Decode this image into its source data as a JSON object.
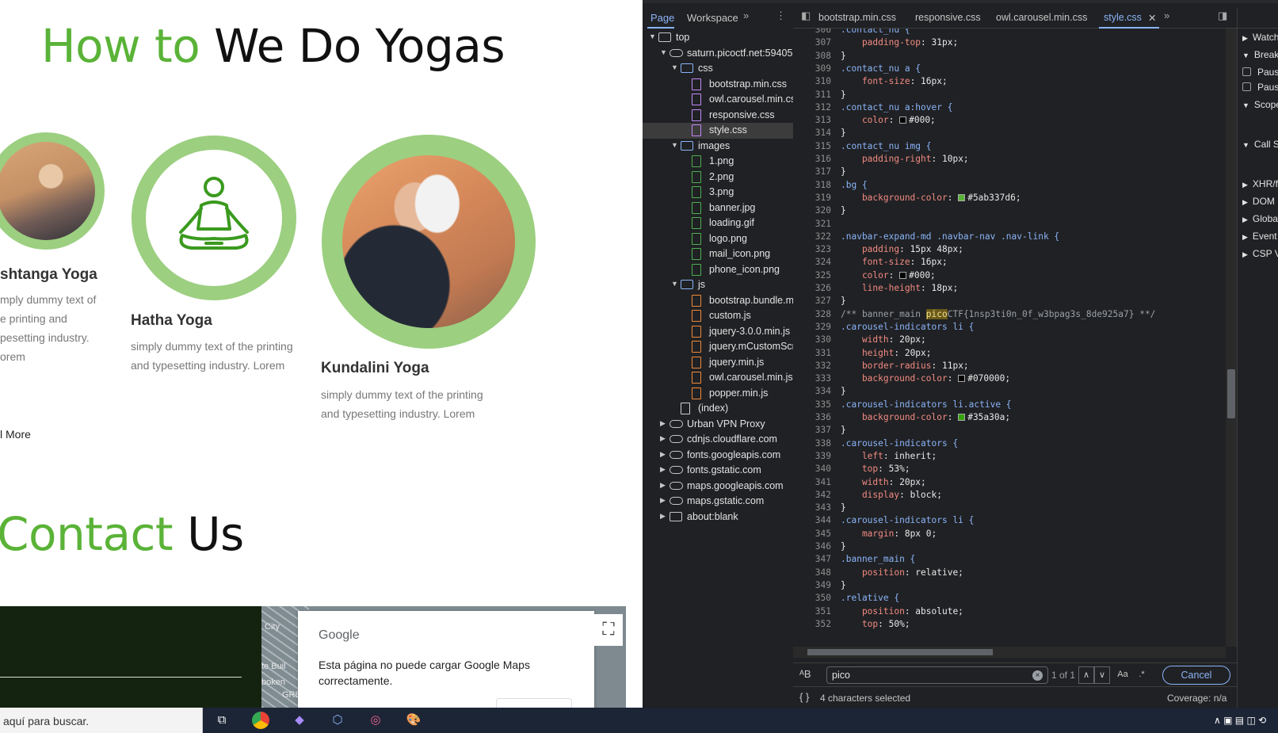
{
  "site": {
    "title_green": "How to",
    "title_rest": "We Do Yogas",
    "yogas": [
      {
        "name": "shtanga Yoga",
        "desc_lines": [
          "mply dummy text of",
          "e printing and",
          "pesetting industry.",
          "orem"
        ]
      },
      {
        "name": "Hatha Yoga",
        "desc_lines": [
          "simply dummy text of the printing",
          "and typesetting industry. Lorem"
        ]
      },
      {
        "name": "Kundalini Yoga",
        "desc_lines": [
          "simply dummy text of the printing",
          "and typesetting industry. Lorem"
        ]
      }
    ],
    "read_more": "l More",
    "contact_green": "Contact",
    "contact_rest": "Us",
    "map": {
      "labels": [
        "City",
        "te Buil",
        "boken",
        "GRE"
      ],
      "google_logo": "Google",
      "message": "Esta página no puede cargar Google Maps correctamente."
    }
  },
  "devtools": {
    "nav_tabs": [
      "Page",
      "Workspace"
    ],
    "tree": [
      {
        "label": "top",
        "kind": "frame",
        "depth": 0,
        "open": true
      },
      {
        "label": "saturn.picoctf.net:59405",
        "kind": "cloud",
        "depth": 1,
        "open": true
      },
      {
        "label": "css",
        "kind": "folder",
        "depth": 2,
        "open": true
      },
      {
        "label": "bootstrap.min.css",
        "kind": "css",
        "depth": 3
      },
      {
        "label": "owl.carousel.min.css",
        "kind": "css",
        "depth": 3
      },
      {
        "label": "responsive.css",
        "kind": "css",
        "depth": 3
      },
      {
        "label": "style.css",
        "kind": "css",
        "depth": 3,
        "selected": true
      },
      {
        "label": "images",
        "kind": "folder",
        "depth": 2,
        "open": true
      },
      {
        "label": "1.png",
        "kind": "img",
        "depth": 3
      },
      {
        "label": "2.png",
        "kind": "img",
        "depth": 3
      },
      {
        "label": "3.png",
        "kind": "img",
        "depth": 3
      },
      {
        "label": "banner.jpg",
        "kind": "img",
        "depth": 3
      },
      {
        "label": "loading.gif",
        "kind": "img",
        "depth": 3
      },
      {
        "label": "logo.png",
        "kind": "img",
        "depth": 3
      },
      {
        "label": "mail_icon.png",
        "kind": "img",
        "depth": 3
      },
      {
        "label": "phone_icon.png",
        "kind": "img",
        "depth": 3
      },
      {
        "label": "js",
        "kind": "folder",
        "depth": 2,
        "open": true
      },
      {
        "label": "bootstrap.bundle.min",
        "kind": "js",
        "depth": 3
      },
      {
        "label": "custom.js",
        "kind": "js",
        "depth": 3
      },
      {
        "label": "jquery-3.0.0.min.js",
        "kind": "js",
        "depth": 3
      },
      {
        "label": "jquery.mCustomScrol",
        "kind": "js",
        "depth": 3
      },
      {
        "label": "jquery.min.js",
        "kind": "js",
        "depth": 3
      },
      {
        "label": "owl.carousel.min.js",
        "kind": "js",
        "depth": 3
      },
      {
        "label": "popper.min.js",
        "kind": "js",
        "depth": 3
      },
      {
        "label": "(index)",
        "kind": "doc",
        "depth": 2
      },
      {
        "label": "Urban VPN Proxy",
        "kind": "cloud",
        "depth": 1,
        "open": false
      },
      {
        "label": "cdnjs.cloudflare.com",
        "kind": "cloud",
        "depth": 1,
        "open": false
      },
      {
        "label": "fonts.googleapis.com",
        "kind": "cloud",
        "depth": 1,
        "open": false
      },
      {
        "label": "fonts.gstatic.com",
        "kind": "cloud",
        "depth": 1,
        "open": false
      },
      {
        "label": "maps.googleapis.com",
        "kind": "cloud",
        "depth": 1,
        "open": false
      },
      {
        "label": "maps.gstatic.com",
        "kind": "cloud",
        "depth": 1,
        "open": false
      },
      {
        "label": "about:blank",
        "kind": "frame",
        "depth": 1,
        "open": false
      }
    ],
    "editor_tabs": [
      "bootstrap.min.css",
      "responsive.css",
      "owl.carousel.min.css",
      "style.css"
    ],
    "code_lines": [
      {
        "n": 306,
        "t": [
          [
            "sel",
            ".contact_nu {"
          ]
        ]
      },
      {
        "n": 307,
        "t": [
          [
            "prop",
            "    padding-top"
          ],
          [
            "val",
            ": 31px;"
          ]
        ]
      },
      {
        "n": 308,
        "t": [
          [
            "val",
            "}"
          ]
        ]
      },
      {
        "n": 309,
        "t": [
          [
            "sel",
            ".contact_nu a {"
          ]
        ]
      },
      {
        "n": 310,
        "t": [
          [
            "prop",
            "    font-size"
          ],
          [
            "val",
            ": 16px;"
          ]
        ]
      },
      {
        "n": 311,
        "t": [
          [
            "val",
            "}"
          ]
        ]
      },
      {
        "n": 312,
        "t": [
          [
            "sel",
            ".contact_nu a:hover {"
          ]
        ]
      },
      {
        "n": 313,
        "t": [
          [
            "prop",
            "    color"
          ],
          [
            "val",
            ": "
          ],
          [
            "sw",
            "#000000"
          ],
          [
            "val",
            "#000;"
          ]
        ]
      },
      {
        "n": 314,
        "t": [
          [
            "val",
            "}"
          ]
        ]
      },
      {
        "n": 315,
        "t": [
          [
            "sel",
            ".contact_nu img {"
          ]
        ]
      },
      {
        "n": 316,
        "t": [
          [
            "prop",
            "    padding-right"
          ],
          [
            "val",
            ": 10px;"
          ]
        ]
      },
      {
        "n": 317,
        "t": [
          [
            "val",
            "}"
          ]
        ]
      },
      {
        "n": 318,
        "t": [
          [
            "sel",
            ".bg {"
          ]
        ]
      },
      {
        "n": 319,
        "t": [
          [
            "prop",
            "    background-color"
          ],
          [
            "val",
            ": "
          ],
          [
            "sw",
            "#5ab337"
          ],
          [
            "val",
            "#5ab337d6;"
          ]
        ]
      },
      {
        "n": 320,
        "t": [
          [
            "val",
            "}"
          ]
        ]
      },
      {
        "n": 321,
        "t": [
          [
            "val",
            ""
          ]
        ]
      },
      {
        "n": 322,
        "t": [
          [
            "sel",
            ".navbar-expand-md .navbar-nav .nav-link {"
          ]
        ]
      },
      {
        "n": 323,
        "t": [
          [
            "prop",
            "    padding"
          ],
          [
            "val",
            ": 15px 48px;"
          ]
        ]
      },
      {
        "n": 324,
        "t": [
          [
            "prop",
            "    font-size"
          ],
          [
            "val",
            ": 16px;"
          ]
        ]
      },
      {
        "n": 325,
        "t": [
          [
            "prop",
            "    color"
          ],
          [
            "val",
            ": "
          ],
          [
            "sw",
            "#000000"
          ],
          [
            "val",
            "#000;"
          ]
        ]
      },
      {
        "n": 326,
        "t": [
          [
            "prop",
            "    line-height"
          ],
          [
            "val",
            ": 18px;"
          ]
        ]
      },
      {
        "n": 327,
        "t": [
          [
            "val",
            "}"
          ]
        ]
      },
      {
        "n": 328,
        "t": [
          [
            "cmt",
            "/** banner_main "
          ],
          [
            "hl",
            "pico"
          ],
          [
            "cmt",
            "CTF{1nsp3ti0n_0f_w3bpag3s_8de925a7} **/"
          ]
        ]
      },
      {
        "n": 329,
        "t": [
          [
            "sel",
            ".carousel-indicators li {"
          ]
        ]
      },
      {
        "n": 330,
        "t": [
          [
            "prop",
            "    width"
          ],
          [
            "val",
            ": 20px;"
          ]
        ]
      },
      {
        "n": 331,
        "t": [
          [
            "prop",
            "    height"
          ],
          [
            "val",
            ": 20px;"
          ]
        ]
      },
      {
        "n": 332,
        "t": [
          [
            "prop",
            "    border-radius"
          ],
          [
            "val",
            ": 11px;"
          ]
        ]
      },
      {
        "n": 333,
        "t": [
          [
            "prop",
            "    background-color"
          ],
          [
            "val",
            ": "
          ],
          [
            "sw",
            "#070000"
          ],
          [
            "val",
            "#070000;"
          ]
        ]
      },
      {
        "n": 334,
        "t": [
          [
            "val",
            "}"
          ]
        ]
      },
      {
        "n": 335,
        "t": [
          [
            "sel",
            ".carousel-indicators li.active {"
          ]
        ]
      },
      {
        "n": 336,
        "t": [
          [
            "prop",
            "    background-color"
          ],
          [
            "val",
            ": "
          ],
          [
            "sw",
            "#35a30a"
          ],
          [
            "val",
            "#35a30a;"
          ]
        ]
      },
      {
        "n": 337,
        "t": [
          [
            "val",
            "}"
          ]
        ]
      },
      {
        "n": 338,
        "t": [
          [
            "sel",
            ".carousel-indicators {"
          ]
        ]
      },
      {
        "n": 339,
        "t": [
          [
            "prop",
            "    left"
          ],
          [
            "val",
            ": inherit;"
          ]
        ]
      },
      {
        "n": 340,
        "t": [
          [
            "prop",
            "    top"
          ],
          [
            "val",
            ": 53%;"
          ]
        ]
      },
      {
        "n": 341,
        "t": [
          [
            "prop",
            "    width"
          ],
          [
            "val",
            ": 20px;"
          ]
        ]
      },
      {
        "n": 342,
        "t": [
          [
            "prop",
            "    display"
          ],
          [
            "val",
            ": block;"
          ]
        ]
      },
      {
        "n": 343,
        "t": [
          [
            "val",
            "}"
          ]
        ]
      },
      {
        "n": 344,
        "t": [
          [
            "sel",
            ".carousel-indicators li {"
          ]
        ]
      },
      {
        "n": 345,
        "t": [
          [
            "prop",
            "    margin"
          ],
          [
            "val",
            ": 8px 0;"
          ]
        ]
      },
      {
        "n": 346,
        "t": [
          [
            "val",
            "}"
          ]
        ]
      },
      {
        "n": 347,
        "t": [
          [
            "sel",
            ".banner_main {"
          ]
        ]
      },
      {
        "n": 348,
        "t": [
          [
            "prop",
            "    position"
          ],
          [
            "val",
            ": relative;"
          ]
        ]
      },
      {
        "n": 349,
        "t": [
          [
            "val",
            "}"
          ]
        ]
      },
      {
        "n": 350,
        "t": [
          [
            "sel",
            ".relative {"
          ]
        ]
      },
      {
        "n": 351,
        "t": [
          [
            "prop",
            "    position"
          ],
          [
            "val",
            ": absolute;"
          ]
        ]
      },
      {
        "n": 352,
        "t": [
          [
            "prop",
            "    top"
          ],
          [
            "val",
            ": 50%;"
          ]
        ]
      }
    ],
    "search": {
      "value": "pico",
      "match_count": "1 of 1",
      "match_case": "Aa",
      "regex": ".*",
      "cancel": "Cancel"
    },
    "status": {
      "selection": "4 characters selected",
      "coverage": "Coverage: n/a"
    },
    "right_pane": [
      "Watch",
      "Break",
      "Pause",
      "Pause",
      "Scope",
      "Call St",
      "XHR/f",
      "DOM",
      "Globa",
      "Event",
      "CSP V"
    ]
  },
  "taskbar": {
    "search_text": "aquí para buscar."
  },
  "colors": {
    "accent_green": "#5ab337",
    "ring_green": "#9ccf80",
    "devtools_bg": "#202124",
    "link_blue": "#8ab4f8"
  }
}
